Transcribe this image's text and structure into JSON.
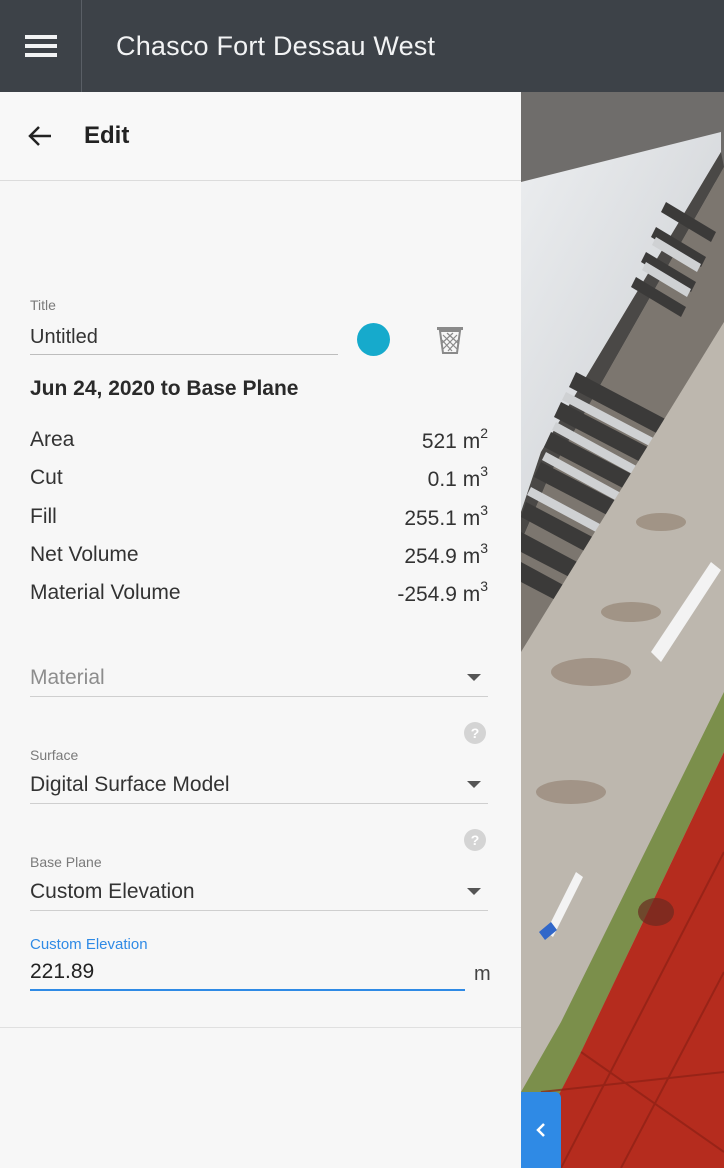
{
  "header": {
    "title": "Chasco Fort Dessau West",
    "menu_icon": "hamburger-menu-icon"
  },
  "panel": {
    "back_icon": "arrow-left-icon",
    "title": "Edit",
    "title_field": {
      "label": "Title",
      "value": "Untitled"
    },
    "color": "#16aacc",
    "delete_icon": "trash-icon",
    "comparison": "Jun 24, 2020 to Base Plane",
    "stats": [
      {
        "label": "Area",
        "value": "521 m",
        "unit_power": "2"
      },
      {
        "label": "Cut",
        "value": "0.1 m",
        "unit_power": "3"
      },
      {
        "label": "Fill",
        "value": "255.1 m",
        "unit_power": "3"
      },
      {
        "label": "Net Volume",
        "value": "254.9 m",
        "unit_power": "3"
      },
      {
        "label": "Material Volume",
        "value": "-254.9 m",
        "unit_power": "3"
      }
    ],
    "material": {
      "placeholder": "Material"
    },
    "surface": {
      "label": "Surface",
      "value": "Digital Surface Model",
      "help": "?"
    },
    "base_plane": {
      "label": "Base Plane",
      "value": "Custom Elevation",
      "help": "?"
    },
    "custom_elevation": {
      "label": "Custom Elevation",
      "value": "221.89",
      "unit": "m"
    }
  },
  "map": {
    "toggle_label": "‹",
    "toggle_icon": "chevron-left-icon"
  },
  "colors": {
    "topbar": "#3d4248",
    "accent": "#2f8ae5",
    "shape_color": "#16aacc"
  }
}
